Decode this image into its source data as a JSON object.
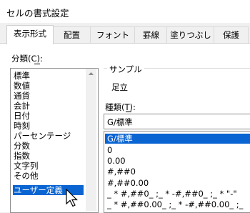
{
  "window": {
    "title": "セルの書式設定"
  },
  "tabs": [
    "表示形式",
    "配置",
    "フォント",
    "罫線",
    "塗りつぶし",
    "保護"
  ],
  "active_tab": 0,
  "category": {
    "label": "分類(C):",
    "items": [
      "標準",
      "数値",
      "通貨",
      "会計",
      "日付",
      "時刻",
      "パーセンテージ",
      "分数",
      "指数",
      "文字列",
      "その他",
      "ユーザー定義"
    ],
    "selected": 11
  },
  "sample": {
    "label": "サンプル",
    "value": "足立"
  },
  "type": {
    "label": "種類(T):",
    "value": "G/標準",
    "options": [
      "G/標準",
      "0",
      "0.00",
      "#,##0",
      "#,##0.00",
      "_ * #,##0_ ;_ * -#,##0_ ;_ * \"-\"",
      "_ * #,##0.00_ ;_ * -#,##0.00_ ;_"
    ],
    "selected": 0
  },
  "colors": {
    "selection": "#0a64d2",
    "panel": "#ffffff",
    "chrome": "#f0f0f0"
  }
}
